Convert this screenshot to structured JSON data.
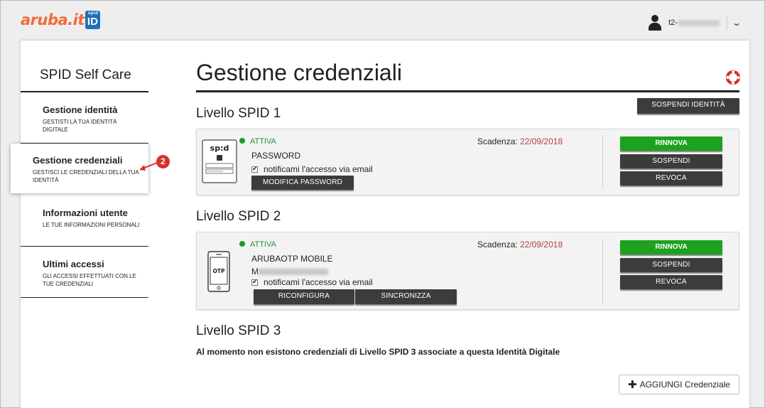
{
  "header": {
    "logo_text": "aruba.it",
    "logo_id": "ID",
    "logo_spid": "spid",
    "user_prefix": "t2-",
    "user_icon": "user-icon",
    "menu_icon": "chevron-down-icon"
  },
  "sidebar": {
    "title": "SPID Self Care",
    "items": [
      {
        "title": "Gestione identità",
        "subtitle": "GESTISTI LA TUA IDENTITÀ DIGITALE"
      },
      {
        "title": "Gestione credenziali",
        "subtitle": "GESTISCI LE CREDENZIALI DELLA TUA IDENTITÀ"
      },
      {
        "title": "Informazioni utente",
        "subtitle": "LE TUE INFORMAZIONI PERSONALI"
      },
      {
        "title": "Ultimi accessi",
        "subtitle": "GLI ACCESSI EFFETTUATI CON LE TUE CREDENZIALI"
      }
    ],
    "active_index": 1,
    "annotation_badge": "2"
  },
  "main": {
    "title": "Gestione credenziali",
    "help_icon": "lifebuoy-icon",
    "suspend_identity_label": "SOSPENDI IDENTITÀ",
    "levels": [
      {
        "title": "Livello SPID 1",
        "status": "ATTIVA",
        "credential_name": "PASSWORD",
        "notify_label": "notificami l'accesso via email",
        "notify_checked": true,
        "expiry_label": "Scadenza:",
        "expiry_date": "22/09/2018",
        "actions": [
          "MODIFICA PASSWORD"
        ],
        "icon": "spid-login-card-icon",
        "icon_text": "sp:d"
      },
      {
        "title": "Livello SPID 2",
        "status": "ATTIVA",
        "credential_name": "ARUBAOTP MOBILE",
        "masked_prefix": "M",
        "notify_label": "notificami l'accesso via email",
        "notify_checked": true,
        "expiry_label": "Scadenza:",
        "expiry_date": "22/09/2018",
        "actions": [
          "RICONFIGURA",
          "SINCRONIZZA"
        ],
        "icon": "otp-phone-icon",
        "icon_text": "OTP"
      }
    ],
    "side_actions": {
      "renew": "RINNOVA",
      "suspend": "SOSPENDI",
      "revoke": "REVOCA"
    },
    "level3": {
      "title": "Livello SPID 3",
      "message": "Al momento non esistono credenziali di Livello SPID 3 associate a questa Identità Digitale"
    },
    "add_button": "AGGIUNGI Credenziale"
  },
  "colors": {
    "brand_orange": "#f26b3a",
    "brand_blue": "#1e6fb8",
    "green": "#1ea11e",
    "dark_button": "#3c3c3c",
    "expiry_red": "#b0413e",
    "badge_red": "#d9302c"
  }
}
